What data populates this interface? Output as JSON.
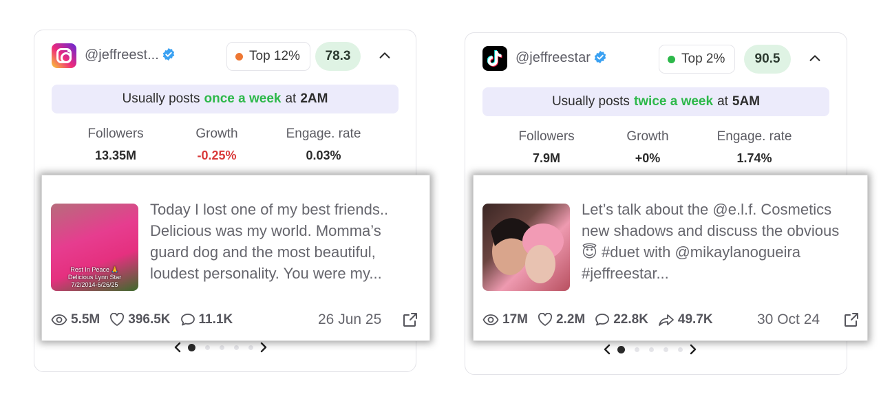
{
  "cards": [
    {
      "platform": "instagram",
      "handle": "@jeffreest...",
      "rank": "Top 12%",
      "rank_color": "#ee7733",
      "score": "78.3",
      "frequency": {
        "prefix": "Usually posts",
        "highlight": "once a week",
        "at": "at",
        "time": "2AM"
      },
      "stats": [
        {
          "label": "Followers",
          "value": "13.35M"
        },
        {
          "label": "Growth",
          "value": "-0.25%"
        },
        {
          "label": "Engage. rate",
          "value": "0.03%"
        }
      ],
      "post": {
        "thumb_caption": "Rest In Peace 🙏\nDelicious Lynn Star\n7/2/2014-6/26/25",
        "text": "Today I lost one of my best friends.. Delicious was my world. Momma’s guard dog and the most beautiful, loudest personality. You were my...",
        "views": "5.5M",
        "likes": "396.5K",
        "comments": "11.1K",
        "date": "26 Jun 25"
      }
    },
    {
      "platform": "tiktok",
      "handle": "@jeffreestar",
      "rank": "Top 2%",
      "rank_color": "#2db84a",
      "score": "90.5",
      "frequency": {
        "prefix": "Usually posts",
        "highlight": "twice a week",
        "at": "at",
        "time": "5AM"
      },
      "stats": [
        {
          "label": "Followers",
          "value": "7.9M"
        },
        {
          "label": "Growth",
          "value": "+0%"
        },
        {
          "label": "Engage. rate",
          "value": "1.74%"
        }
      ],
      "post": {
        "text": "Let’s talk about the @e.l.f. Cosmetics new shadows and discuss the obvious 😇 #duet with @mikaylanogueira #jeffreestar...",
        "views": "17M",
        "likes": "2.2M",
        "comments": "22.8K",
        "shares": "49.7K",
        "date": "30 Oct 24"
      }
    }
  ]
}
